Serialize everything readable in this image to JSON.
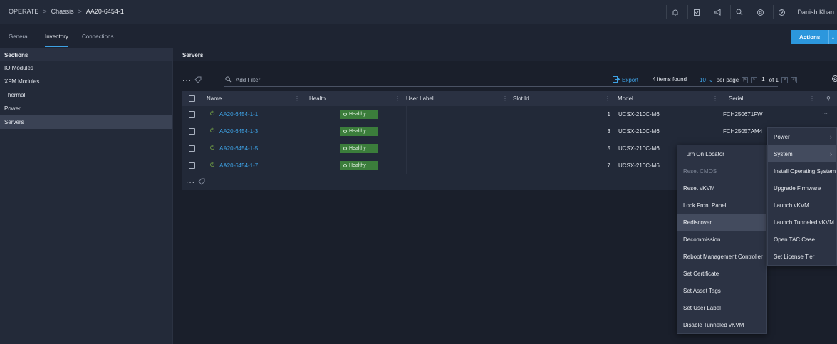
{
  "breadcrumb": {
    "root": "OPERATE",
    "section": "Chassis",
    "current": "AA20-6454-1",
    "sep": ">"
  },
  "topbar": {
    "icons": [
      "bell-icon",
      "clipboard-icon",
      "megaphone-icon",
      "search-icon",
      "settings-icon",
      "help-icon"
    ],
    "user": "Danish Khan"
  },
  "tabs": [
    "General",
    "Inventory",
    "Connections"
  ],
  "actions": {
    "label": "Actions",
    "caret": "⌄"
  },
  "sidebar": {
    "heading": "Sections",
    "items": [
      "IO Modules",
      "XFM Modules",
      "Thermal",
      "Power",
      "Servers"
    ]
  },
  "main": {
    "heading": "Servers"
  },
  "toolbar": {
    "filter_placeholder": "Add Filter",
    "export": "Export",
    "found": "4 items found",
    "per_page_value": "10",
    "per_page_label": "per page",
    "page_current": "1",
    "page_of": "of 1"
  },
  "table": {
    "columns": [
      "Name",
      "Health",
      "User Label",
      "Slot Id",
      "Model",
      "Serial"
    ],
    "rows": [
      {
        "name": "AA20-6454-1-1",
        "health": "Healthy",
        "user_label": "",
        "slot": "1",
        "model": "UCSX-210C-M6",
        "serial": "FCH250671FW"
      },
      {
        "name": "AA20-6454-1-3",
        "health": "Healthy",
        "user_label": "",
        "slot": "3",
        "model": "UCSX-210C-M6",
        "serial": "FCH25057AM4"
      },
      {
        "name": "AA20-6454-1-5",
        "health": "Healthy",
        "user_label": "",
        "slot": "5",
        "model": "UCSX-210C-M6",
        "serial": ""
      },
      {
        "name": "AA20-6454-1-7",
        "health": "Healthy",
        "user_label": "",
        "slot": "7",
        "model": "UCSX-210C-M6",
        "serial": ""
      }
    ]
  },
  "row_menu": {
    "items": [
      "Power",
      "System",
      "Install Operating System",
      "Upgrade Firmware",
      "Launch vKVM",
      "Launch Tunneled vKVM",
      "Open TAC Case",
      "Set License Tier"
    ]
  },
  "system_submenu": {
    "items": [
      "Turn On Locator",
      "Reset CMOS",
      "Reset vKVM",
      "Lock Front Panel",
      "Rediscover",
      "Decommission",
      "Reboot Management Controller",
      "Set Certificate",
      "Set Asset Tags",
      "Set User Label",
      "Disable Tunneled vKVM"
    ]
  },
  "colors": {
    "accent": "#3ea2e5",
    "healthy": "#3b7d3b",
    "background": "#1a1f2b"
  }
}
